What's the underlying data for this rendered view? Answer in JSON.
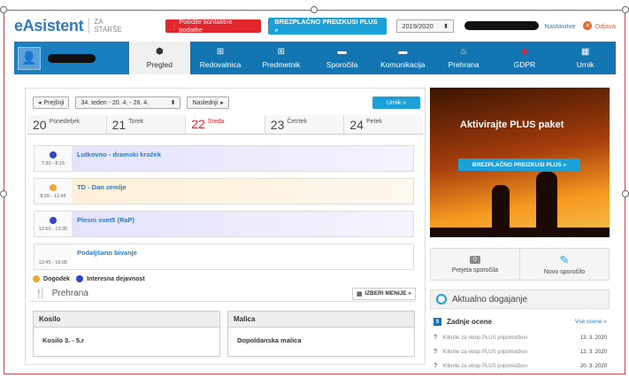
{
  "header": {
    "logo": "eAsistent",
    "logo_sub": "ZA STARŠE",
    "warning_button": "Potrdite kontaktne podatke",
    "plus_button": "BREZPLAČNO PREIZKUSI PLUS »",
    "year": "2019/2020",
    "settings": "Nastavitve",
    "logout": "Odjava"
  },
  "nav": {
    "items": [
      {
        "label": "Pregled",
        "icon": "cube-icon",
        "glyph": "⬢"
      },
      {
        "label": "Redovalnica",
        "icon": "plus-square-icon",
        "glyph": "⊞"
      },
      {
        "label": "Predmetnik",
        "icon": "plus-square-icon",
        "glyph": "⊞"
      },
      {
        "label": "Sporočila",
        "icon": "chat-icon",
        "glyph": "▬"
      },
      {
        "label": "Komunikacija",
        "icon": "chat-icon",
        "glyph": "▬"
      },
      {
        "label": "Prehrana",
        "icon": "food-icon",
        "glyph": "♨"
      },
      {
        "label": "GDPR",
        "icon": "gdpr-icon",
        "glyph": "◉"
      },
      {
        "label": "Urnik",
        "icon": "calendar-icon",
        "glyph": "▦"
      }
    ]
  },
  "week": {
    "prev": "Prejšnji",
    "range": "34. teden - 20. 4. - 26. 4.",
    "next": "Naslednji",
    "urnik": "Urnik »"
  },
  "days": [
    {
      "num": "20",
      "name": "Ponedeljek"
    },
    {
      "num": "21",
      "name": "Torek"
    },
    {
      "num": "22",
      "name": "Sreda"
    },
    {
      "num": "23",
      "name": "Četrtek"
    },
    {
      "num": "24",
      "name": "Petek"
    }
  ],
  "events": [
    {
      "time": "7:30 - 8:15",
      "title": "Lutkovno - dramski krožek",
      "kind": "Interesna dejavnost"
    },
    {
      "time": "8:20 - 12:45",
      "title": "TD - Dan zemlje",
      "kind": "Dogodek"
    },
    {
      "time": "12:50 - 13:35",
      "title": "Plesni svet5 (RaP)",
      "kind": "Interesna dejavnost"
    },
    {
      "time": "12:45 - 16:05",
      "title": "Podaljšano bivanje",
      "kind": ""
    }
  ],
  "legend": {
    "event": "Dogodek",
    "activity": "Interesna dejavnost"
  },
  "prehrana": {
    "title": "Prehrana",
    "choose": "IZBERI MENIJE »",
    "kosilo_head": "Kosilo",
    "kosilo_value": "Kosilo 3. - 5.r",
    "malica_head": "Malica",
    "malica_value": "Dopoldanska malica"
  },
  "promo": {
    "title": "Aktivirajte PLUS paket",
    "button": "BREZPLAČNO PREIZKUSI PLUS »"
  },
  "messages": {
    "read_count": "0",
    "read_label": "Prejeta sporočila",
    "new_label": "Novo sporočilo"
  },
  "news": {
    "title": "Aktualno dogajanje",
    "grades_title": "Zadnje ocene",
    "grades_link": "Vse ocene »",
    "grades": [
      {
        "text": "Kliknite za vklop PLUS pripomočkov",
        "date": "13. 3. 2020"
      },
      {
        "text": "Kliknite za vklop PLUS pripomočkov",
        "date": "12. 3. 2020"
      },
      {
        "text": "Kliknite za vklop PLUS pripomočkov",
        "date": "20. 3. 2020"
      }
    ]
  },
  "colors": {
    "primary": "#1475b3",
    "accent": "#1ba0d8",
    "danger": "#e2262e",
    "event_dot": "#f0a830",
    "activity_dot": "#3344cc"
  }
}
